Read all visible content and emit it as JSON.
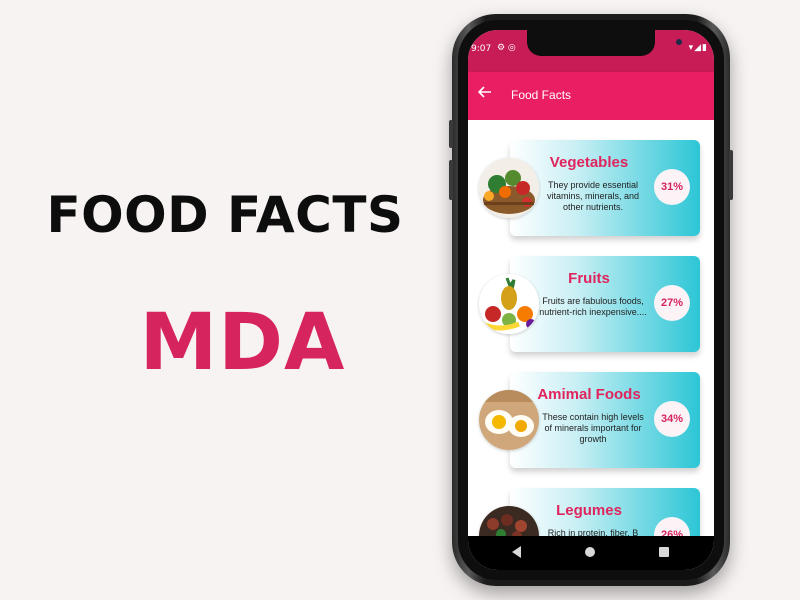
{
  "promo": {
    "title": "FOOD FACTS",
    "subtitle": "MDA"
  },
  "status_bar": {
    "time": "9:07",
    "left_icons": "⚙ ◎",
    "right_icons": "▾◢▮"
  },
  "app_bar": {
    "title": "Food Facts"
  },
  "foods": [
    {
      "title": "Vegetables",
      "description": "They provide essential vitamins, minerals, and other nutrients.",
      "percent": "31%",
      "image": "vegetable-basket"
    },
    {
      "title": "Fruits",
      "description": "Fruits are fabulous foods, nutrient-rich inexpensive....",
      "percent": "27%",
      "image": "fruit-assortment"
    },
    {
      "title": "Amimal Foods",
      "description": "These contain high levels of minerals important for growth",
      "percent": "34%",
      "image": "boiled-eggs"
    },
    {
      "title": "Legumes",
      "description": "Rich in protein, fiber, B",
      "percent": "26%",
      "image": "legume-bowl"
    }
  ],
  "colors": {
    "accent": "#e91e63",
    "status_bar": "#c71c55",
    "promo_subtitle": "#d6245e",
    "card_gradient_end": "#2cc6d6"
  }
}
